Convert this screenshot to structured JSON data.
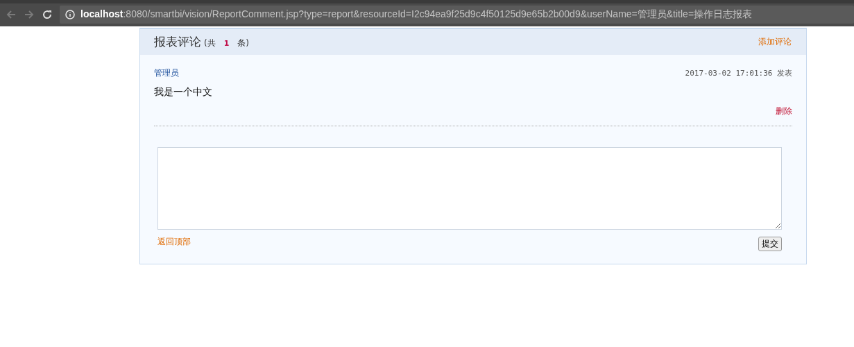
{
  "browser": {
    "address_host": "localhost",
    "address_rest": ":8080/smartbi/vision/ReportComment.jsp?type=report&resourceId=I2c94ea9f25d9c4f50125d9e65b2b00d9&userName=管理员&title=操作日志报表"
  },
  "panel": {
    "title": "报表评论",
    "count_prefix": "(共",
    "count": "1",
    "count_suffix": "条)",
    "add_link": "添加评论"
  },
  "comments": [
    {
      "author": "管理员",
      "time": "2017-03-02 17:01:36",
      "time_suffix": "发表",
      "text": "我是一个中文",
      "delete_link": "删除"
    }
  ],
  "form": {
    "back_link": "返回顶部",
    "submit": "提交"
  }
}
